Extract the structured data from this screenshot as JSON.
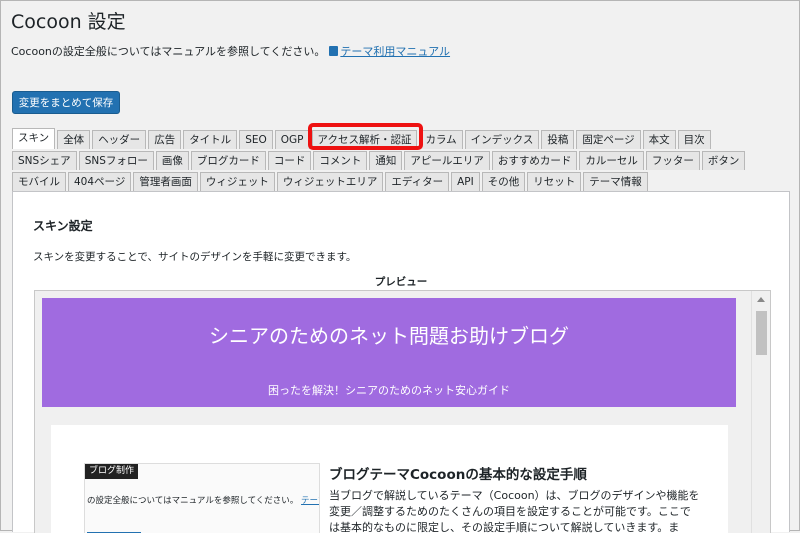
{
  "page": {
    "title": "Cocoon 設定",
    "intro_text": "Cocoonの設定全般についてはマニュアルを参照してください。",
    "manual_link": "テーマ利用マニュアル",
    "save_label": "変更をまとめて保存"
  },
  "tabs": {
    "rows": [
      [
        "スキン",
        "全体",
        "ヘッダー",
        "広告",
        "タイトル",
        "SEO",
        "OGP",
        "アクセス解析・認証",
        "カラム",
        "インデックス",
        "投稿",
        "固定ページ",
        "本文",
        "目次"
      ],
      [
        "SNSシェア",
        "SNSフォロー",
        "画像",
        "ブログカード",
        "コード",
        "コメント",
        "通知",
        "アピールエリア",
        "おすすめカード",
        "カルーセル",
        "フッター",
        "ボタン"
      ],
      [
        "モバイル",
        "404ページ",
        "管理者画面",
        "ウィジェット",
        "ウィジェットエリア",
        "エディター",
        "API",
        "その他",
        "リセット",
        "テーマ情報"
      ]
    ],
    "active": "スキン",
    "highlighted": "アクセス解析・認証"
  },
  "skin": {
    "heading": "スキン設定",
    "description": "スキンを変更することで、サイトのデザインを手軽に変更できます。",
    "preview_label": "プレビュー"
  },
  "preview": {
    "site_title": "シニアのためのネット問題お助けブログ",
    "tagline": "困ったを解決！シニアのためのネット安心ガイド",
    "header_color": "#a06be0",
    "thumb_badge": "ブログ制作",
    "thumb_text": "の設定全般についてはマニュアルを参照してください。",
    "thumb_link": "テーマ利用マニ",
    "article_title": "ブログテーマCocoonの基本的な設定手順",
    "article_body": "当ブログで解説しているテーマ（Cocoon）は、ブログのデザインや機能を変更／調整するためのたくさんの項目を設定することが可能です。ここでは基本的なものに限定し、その設定手順について解説していきます。ま"
  }
}
